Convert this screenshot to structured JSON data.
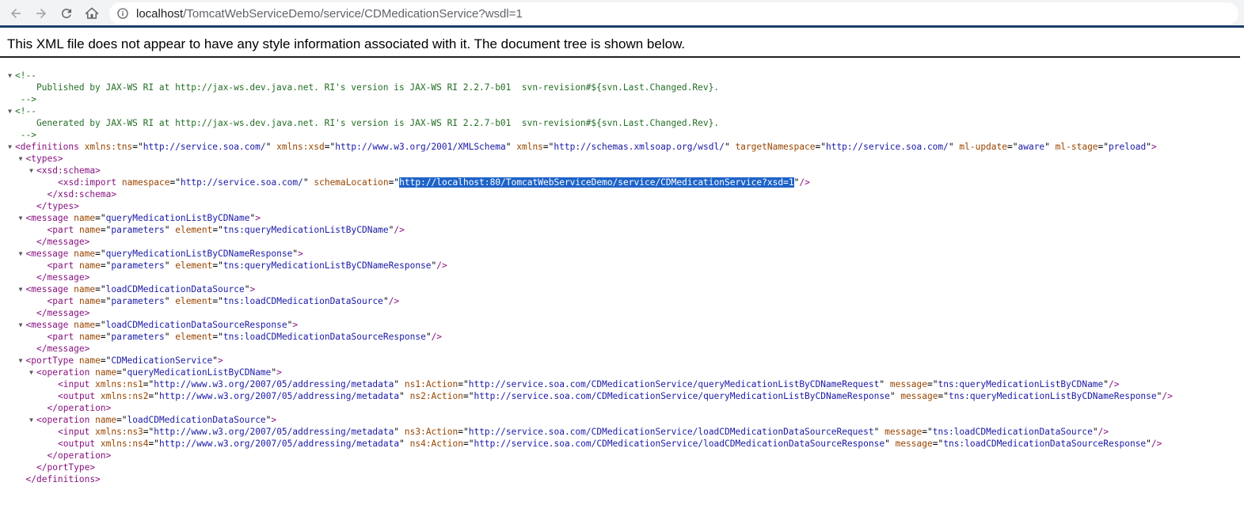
{
  "browser": {
    "url_host": "localhost",
    "url_path": "/TomcatWebServiceDemo/service/CDMedicationService?wsdl=1",
    "icons": {
      "back": "arrow-left-icon",
      "forward": "arrow-right-icon",
      "reload": "reload-icon",
      "home": "home-icon",
      "info": "info-icon"
    }
  },
  "viewer": {
    "header": "This XML file does not appear to have any style information associated with it. The document tree is shown below."
  },
  "tree": {
    "lines": [
      {
        "indent": 0,
        "toggle": true,
        "segs": [
          [
            "c",
            "<!--"
          ]
        ]
      },
      {
        "indent": 0,
        "toggle": false,
        "segs": [
          [
            "c",
            "    Published by JAX-WS RI at http://jax-ws.dev.java.net. RI's version is JAX-WS RI 2.2.7-b01  svn-revision#${svn.Last.Changed.Rev}."
          ]
        ]
      },
      {
        "indent": 0,
        "toggle": false,
        "segs": [
          [
            "c",
            " -->"
          ]
        ]
      },
      {
        "indent": 0,
        "toggle": true,
        "segs": [
          [
            "c",
            "<!--"
          ]
        ]
      },
      {
        "indent": 0,
        "toggle": false,
        "segs": [
          [
            "c",
            "    Generated by JAX-WS RI at http://jax-ws.dev.java.net. RI's version is JAX-WS RI 2.2.7-b01  svn-revision#${svn.Last.Changed.Rev}."
          ]
        ]
      },
      {
        "indent": 0,
        "toggle": false,
        "segs": [
          [
            "c",
            " -->"
          ]
        ]
      },
      {
        "indent": 0,
        "toggle": true,
        "segs": [
          [
            "t",
            "<definitions"
          ],
          [
            "p",
            " "
          ],
          [
            "a",
            "xmlns:tns"
          ],
          [
            "p",
            "=\""
          ],
          [
            "v",
            "http://service.soa.com/"
          ],
          [
            "p",
            "\" "
          ],
          [
            "a",
            "xmlns:xsd"
          ],
          [
            "p",
            "=\""
          ],
          [
            "v",
            "http://www.w3.org/2001/XMLSchema"
          ],
          [
            "p",
            "\" "
          ],
          [
            "a",
            "xmlns"
          ],
          [
            "p",
            "=\""
          ],
          [
            "v",
            "http://schemas.xmlsoap.org/wsdl/"
          ],
          [
            "p",
            "\" "
          ],
          [
            "a",
            "targetNamespace"
          ],
          [
            "p",
            "=\""
          ],
          [
            "v",
            "http://service.soa.com/"
          ],
          [
            "p",
            "\" "
          ],
          [
            "a",
            "ml-update"
          ],
          [
            "p",
            "=\""
          ],
          [
            "v",
            "aware"
          ],
          [
            "p",
            "\" "
          ],
          [
            "a",
            "ml-stage"
          ],
          [
            "p",
            "=\""
          ],
          [
            "v",
            "preload"
          ],
          [
            "p",
            "\""
          ],
          [
            "t",
            ">"
          ]
        ]
      },
      {
        "indent": 1,
        "toggle": true,
        "segs": [
          [
            "t",
            "<types>"
          ]
        ]
      },
      {
        "indent": 2,
        "toggle": true,
        "segs": [
          [
            "t",
            "<xsd:schema>"
          ]
        ]
      },
      {
        "indent": 4,
        "toggle": false,
        "segs": [
          [
            "t",
            "<xsd:import"
          ],
          [
            "p",
            " "
          ],
          [
            "a",
            "namespace"
          ],
          [
            "p",
            "=\""
          ],
          [
            "v",
            "http://service.soa.com/"
          ],
          [
            "p",
            "\" "
          ],
          [
            "a",
            "schemaLocation"
          ],
          [
            "p",
            "=\""
          ],
          [
            "sel",
            "http://localhost:80/TomcatWebServiceDemo/service/CDMedicationService?xsd=1"
          ],
          [
            "p",
            "\""
          ],
          [
            "t",
            "/>"
          ]
        ]
      },
      {
        "indent": 3,
        "toggle": false,
        "segs": [
          [
            "t",
            "</xsd:schema>"
          ]
        ]
      },
      {
        "indent": 2,
        "toggle": false,
        "segs": [
          [
            "t",
            "</types>"
          ]
        ]
      },
      {
        "indent": 1,
        "toggle": true,
        "segs": [
          [
            "t",
            "<message"
          ],
          [
            "p",
            " "
          ],
          [
            "a",
            "name"
          ],
          [
            "p",
            "=\""
          ],
          [
            "v",
            "queryMedicationListByCDName"
          ],
          [
            "p",
            "\""
          ],
          [
            "t",
            ">"
          ]
        ]
      },
      {
        "indent": 3,
        "toggle": false,
        "segs": [
          [
            "t",
            "<part"
          ],
          [
            "p",
            " "
          ],
          [
            "a",
            "name"
          ],
          [
            "p",
            "=\""
          ],
          [
            "v",
            "parameters"
          ],
          [
            "p",
            "\" "
          ],
          [
            "a",
            "element"
          ],
          [
            "p",
            "=\""
          ],
          [
            "v",
            "tns:queryMedicationListByCDName"
          ],
          [
            "p",
            "\""
          ],
          [
            "t",
            "/>"
          ]
        ]
      },
      {
        "indent": 2,
        "toggle": false,
        "segs": [
          [
            "t",
            "</message>"
          ]
        ]
      },
      {
        "indent": 1,
        "toggle": true,
        "segs": [
          [
            "t",
            "<message"
          ],
          [
            "p",
            " "
          ],
          [
            "a",
            "name"
          ],
          [
            "p",
            "=\""
          ],
          [
            "v",
            "queryMedicationListByCDNameResponse"
          ],
          [
            "p",
            "\""
          ],
          [
            "t",
            ">"
          ]
        ]
      },
      {
        "indent": 3,
        "toggle": false,
        "segs": [
          [
            "t",
            "<part"
          ],
          [
            "p",
            " "
          ],
          [
            "a",
            "name"
          ],
          [
            "p",
            "=\""
          ],
          [
            "v",
            "parameters"
          ],
          [
            "p",
            "\" "
          ],
          [
            "a",
            "element"
          ],
          [
            "p",
            "=\""
          ],
          [
            "v",
            "tns:queryMedicationListByCDNameResponse"
          ],
          [
            "p",
            "\""
          ],
          [
            "t",
            "/>"
          ]
        ]
      },
      {
        "indent": 2,
        "toggle": false,
        "segs": [
          [
            "t",
            "</message>"
          ]
        ]
      },
      {
        "indent": 1,
        "toggle": true,
        "segs": [
          [
            "t",
            "<message"
          ],
          [
            "p",
            " "
          ],
          [
            "a",
            "name"
          ],
          [
            "p",
            "=\""
          ],
          [
            "v",
            "loadCDMedicationDataSource"
          ],
          [
            "p",
            "\""
          ],
          [
            "t",
            ">"
          ]
        ]
      },
      {
        "indent": 3,
        "toggle": false,
        "segs": [
          [
            "t",
            "<part"
          ],
          [
            "p",
            " "
          ],
          [
            "a",
            "name"
          ],
          [
            "p",
            "=\""
          ],
          [
            "v",
            "parameters"
          ],
          [
            "p",
            "\" "
          ],
          [
            "a",
            "element"
          ],
          [
            "p",
            "=\""
          ],
          [
            "v",
            "tns:loadCDMedicationDataSource"
          ],
          [
            "p",
            "\""
          ],
          [
            "t",
            "/>"
          ]
        ]
      },
      {
        "indent": 2,
        "toggle": false,
        "segs": [
          [
            "t",
            "</message>"
          ]
        ]
      },
      {
        "indent": 1,
        "toggle": true,
        "segs": [
          [
            "t",
            "<message"
          ],
          [
            "p",
            " "
          ],
          [
            "a",
            "name"
          ],
          [
            "p",
            "=\""
          ],
          [
            "v",
            "loadCDMedicationDataSourceResponse"
          ],
          [
            "p",
            "\""
          ],
          [
            "t",
            ">"
          ]
        ]
      },
      {
        "indent": 3,
        "toggle": false,
        "segs": [
          [
            "t",
            "<part"
          ],
          [
            "p",
            " "
          ],
          [
            "a",
            "name"
          ],
          [
            "p",
            "=\""
          ],
          [
            "v",
            "parameters"
          ],
          [
            "p",
            "\" "
          ],
          [
            "a",
            "element"
          ],
          [
            "p",
            "=\""
          ],
          [
            "v",
            "tns:loadCDMedicationDataSourceResponse"
          ],
          [
            "p",
            "\""
          ],
          [
            "t",
            "/>"
          ]
        ]
      },
      {
        "indent": 2,
        "toggle": false,
        "segs": [
          [
            "t",
            "</message>"
          ]
        ]
      },
      {
        "indent": 1,
        "toggle": true,
        "segs": [
          [
            "t",
            "<portType"
          ],
          [
            "p",
            " "
          ],
          [
            "a",
            "name"
          ],
          [
            "p",
            "=\""
          ],
          [
            "v",
            "CDMedicationService"
          ],
          [
            "p",
            "\""
          ],
          [
            "t",
            ">"
          ]
        ]
      },
      {
        "indent": 2,
        "toggle": true,
        "segs": [
          [
            "t",
            "<operation"
          ],
          [
            "p",
            " "
          ],
          [
            "a",
            "name"
          ],
          [
            "p",
            "=\""
          ],
          [
            "v",
            "queryMedicationListByCDName"
          ],
          [
            "p",
            "\""
          ],
          [
            "t",
            ">"
          ]
        ]
      },
      {
        "indent": 4,
        "toggle": false,
        "segs": [
          [
            "t",
            "<input"
          ],
          [
            "p",
            " "
          ],
          [
            "a",
            "xmlns:ns1"
          ],
          [
            "p",
            "=\""
          ],
          [
            "v",
            "http://www.w3.org/2007/05/addressing/metadata"
          ],
          [
            "p",
            "\" "
          ],
          [
            "a",
            "ns1:Action"
          ],
          [
            "p",
            "=\""
          ],
          [
            "v",
            "http://service.soa.com/CDMedicationService/queryMedicationListByCDNameRequest"
          ],
          [
            "p",
            "\" "
          ],
          [
            "a",
            "message"
          ],
          [
            "p",
            "=\""
          ],
          [
            "v",
            "tns:queryMedicationListByCDName"
          ],
          [
            "p",
            "\""
          ],
          [
            "t",
            "/>"
          ]
        ]
      },
      {
        "indent": 4,
        "toggle": false,
        "segs": [
          [
            "t",
            "<output"
          ],
          [
            "p",
            " "
          ],
          [
            "a",
            "xmlns:ns2"
          ],
          [
            "p",
            "=\""
          ],
          [
            "v",
            "http://www.w3.org/2007/05/addressing/metadata"
          ],
          [
            "p",
            "\" "
          ],
          [
            "a",
            "ns2:Action"
          ],
          [
            "p",
            "=\""
          ],
          [
            "v",
            "http://service.soa.com/CDMedicationService/queryMedicationListByCDNameResponse"
          ],
          [
            "p",
            "\" "
          ],
          [
            "a",
            "message"
          ],
          [
            "p",
            "=\""
          ],
          [
            "v",
            "tns:queryMedicationListByCDNameResponse"
          ],
          [
            "p",
            "\""
          ],
          [
            "t",
            "/>"
          ]
        ]
      },
      {
        "indent": 3,
        "toggle": false,
        "segs": [
          [
            "t",
            "</operation>"
          ]
        ]
      },
      {
        "indent": 2,
        "toggle": true,
        "segs": [
          [
            "t",
            "<operation"
          ],
          [
            "p",
            " "
          ],
          [
            "a",
            "name"
          ],
          [
            "p",
            "=\""
          ],
          [
            "v",
            "loadCDMedicationDataSource"
          ],
          [
            "p",
            "\""
          ],
          [
            "t",
            ">"
          ]
        ]
      },
      {
        "indent": 4,
        "toggle": false,
        "segs": [
          [
            "t",
            "<input"
          ],
          [
            "p",
            " "
          ],
          [
            "a",
            "xmlns:ns3"
          ],
          [
            "p",
            "=\""
          ],
          [
            "v",
            "http://www.w3.org/2007/05/addressing/metadata"
          ],
          [
            "p",
            "\" "
          ],
          [
            "a",
            "ns3:Action"
          ],
          [
            "p",
            "=\""
          ],
          [
            "v",
            "http://service.soa.com/CDMedicationService/loadCDMedicationDataSourceRequest"
          ],
          [
            "p",
            "\" "
          ],
          [
            "a",
            "message"
          ],
          [
            "p",
            "=\""
          ],
          [
            "v",
            "tns:loadCDMedicationDataSource"
          ],
          [
            "p",
            "\""
          ],
          [
            "t",
            "/>"
          ]
        ]
      },
      {
        "indent": 4,
        "toggle": false,
        "segs": [
          [
            "t",
            "<output"
          ],
          [
            "p",
            " "
          ],
          [
            "a",
            "xmlns:ns4"
          ],
          [
            "p",
            "=\""
          ],
          [
            "v",
            "http://www.w3.org/2007/05/addressing/metadata"
          ],
          [
            "p",
            "\" "
          ],
          [
            "a",
            "ns4:Action"
          ],
          [
            "p",
            "=\""
          ],
          [
            "v",
            "http://service.soa.com/CDMedicationService/loadCDMedicationDataSourceResponse"
          ],
          [
            "p",
            "\" "
          ],
          [
            "a",
            "message"
          ],
          [
            "p",
            "=\""
          ],
          [
            "v",
            "tns:loadCDMedicationDataSourceResponse"
          ],
          [
            "p",
            "\""
          ],
          [
            "t",
            "/>"
          ]
        ]
      },
      {
        "indent": 3,
        "toggle": false,
        "segs": [
          [
            "t",
            "</operation>"
          ]
        ]
      },
      {
        "indent": 2,
        "toggle": false,
        "segs": [
          [
            "t",
            "</portType>"
          ]
        ]
      },
      {
        "indent": 1,
        "toggle": false,
        "segs": [
          [
            "t",
            "</definitions>"
          ]
        ]
      }
    ]
  }
}
